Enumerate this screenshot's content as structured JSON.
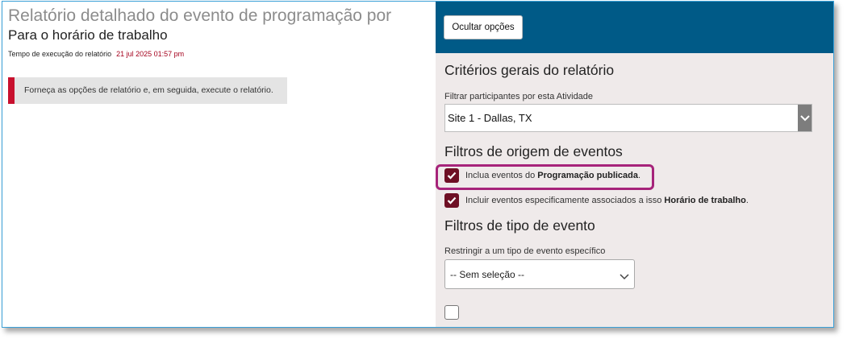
{
  "report": {
    "title": "Relatório detalhado do evento de programação por",
    "subtitle": "Para o horário de trabalho",
    "run_time_label": "Tempo de execução do relatório",
    "run_time_value": "21 jul 2025 01:57 pm",
    "notice": "Forneça as opções de relatório e, em seguida, execute o relatório."
  },
  "options": {
    "hide_button": "Ocultar opções",
    "general": {
      "title": "Critérios gerais do relatório",
      "filter_label": "Filtrar participantes por esta Atividade",
      "filter_value": "Site 1 - Dallas, TX"
    },
    "origin": {
      "title": "Filtros de origem de eventos",
      "cb1_text": "Inclua eventos do ",
      "cb1_bold": "Programação publicada",
      "cb1_end": ".",
      "cb1_checked": true,
      "cb2_text": "Incluir eventos especificamente associados a isso ",
      "cb2_bold": "Horário de trabalho",
      "cb2_end": ".",
      "cb2_checked": true
    },
    "type": {
      "title": "Filtros de tipo de evento",
      "restrict_label": "Restringir a um tipo de evento específico",
      "restrict_value": "-- Sem seleção --",
      "cb3_checked": false
    }
  },
  "colors": {
    "header_bg": "#005a87",
    "accent_red": "#c8102e",
    "checkbox": "#6e0f24",
    "highlight": "#a6237a"
  }
}
